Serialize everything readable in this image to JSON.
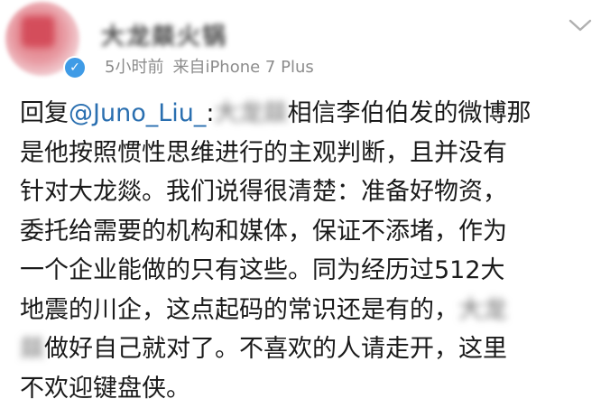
{
  "post": {
    "author": {
      "name": "大龙燚火锅",
      "avatar": "avatar-icon",
      "verified_badge": "verified-badge-icon"
    },
    "meta": {
      "time": "5小时前",
      "source": "来自iPhone 7 Plus"
    },
    "menu_icon": "chevron-down-icon",
    "body": {
      "reply_prefix": "回复",
      "mention": "@Juno_Liu_",
      "line1_colon": ":",
      "line1_blur": "大龙燚",
      "line1_rest": "相信李伯伯发的微博那",
      "line2": "是他按照惯性思维进行的主观判断，且并没有",
      "line3": "针对大龙燚。我们说得很清楚：准备好物资，",
      "line4": "委托给需要的机构和媒体，保证不添堵，作为",
      "line5": "一个企业能做的只有这些。同为经历过512大",
      "line6_start": "地震的川企，这点起码的常识还是有的，",
      "line6_blur": "大龙",
      "line7_blur": "燚",
      "line7_rest": "做好自己就对了。不喜欢的人请走开，这里",
      "line8": "不欢迎键盘侠。"
    }
  },
  "colors": {
    "mention": "#2a6fb0",
    "meta_text": "#8c8c8c",
    "verified": "#3f9be6"
  }
}
